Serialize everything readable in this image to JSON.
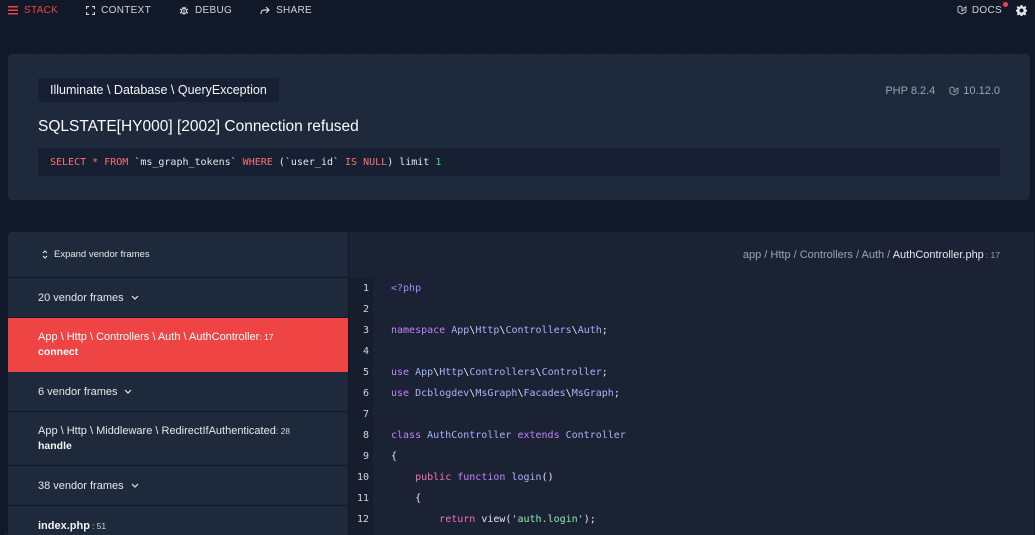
{
  "nav": {
    "stack": "STACK",
    "context": "CONTEXT",
    "debug": "DEBUG",
    "share": "SHARE",
    "docs": "DOCS"
  },
  "header": {
    "exception_class": "Illuminate \\ Database \\ QueryException",
    "php_version": "PHP 8.2.4",
    "laravel_version": "10.12.0",
    "message": "SQLSTATE[HY000] [2002] Connection refused",
    "sql": {
      "select": "SELECT",
      "star": " * ",
      "from": "FROM",
      "table": " `ms_graph_tokens` ",
      "where": "WHERE",
      "cond": " (`user_id` ",
      "isnull": "IS NULL",
      "limit": ") limit ",
      "limit_val": "1"
    }
  },
  "frames": {
    "expand_label": "Expand vendor frames",
    "vendor1": "20 vendor frames",
    "active": {
      "path": "App \\ Http \\ Controllers \\ Auth \\ AuthController",
      "line": ": 17",
      "fn": "connect"
    },
    "vendor2": "6 vendor frames",
    "middleware": {
      "path": "App \\ Http \\ Middleware \\ RedirectIfAuthenticated",
      "line": ": 28",
      "fn": "handle"
    },
    "vendor3": "38 vendor frames",
    "index": {
      "file": "index.php",
      "line": ": 51"
    }
  },
  "code": {
    "path_prefix": "app / Http / Controllers / Auth / ",
    "file_name": "AuthController.php",
    "line_suffix": ": 17",
    "lines": [
      "1",
      "2",
      "3",
      "4",
      "5",
      "6",
      "7",
      "8",
      "9",
      "10",
      "11",
      "12"
    ],
    "l1": "<?php",
    "l3_kw": "namespace ",
    "l3_a": "App",
    "l3_b": "Http",
    "l3_c": "Controllers",
    "l3_d": "Auth",
    "l5_kw": "use ",
    "l5_a": "App",
    "l5_b": "Http",
    "l5_c": "Controllers",
    "l5_d": "Controller",
    "l6_kw": "use ",
    "l6_a": "Dcblogdev",
    "l6_b": "MsGraph",
    "l6_c": "Facades",
    "l6_d": "MsGraph",
    "l8_class": "class ",
    "l8_name": "AuthController",
    "l8_ext": " extends ",
    "l8_parent": "Controller",
    "l9": "{",
    "l10_pub": "public ",
    "l10_fn": "function ",
    "l10_name": "login",
    "l10_paren": "()",
    "l11": "{",
    "l12_ret": "return ",
    "l12_view": "view(",
    "l12_str": "'auth.login'",
    "l12_end": ");"
  }
}
